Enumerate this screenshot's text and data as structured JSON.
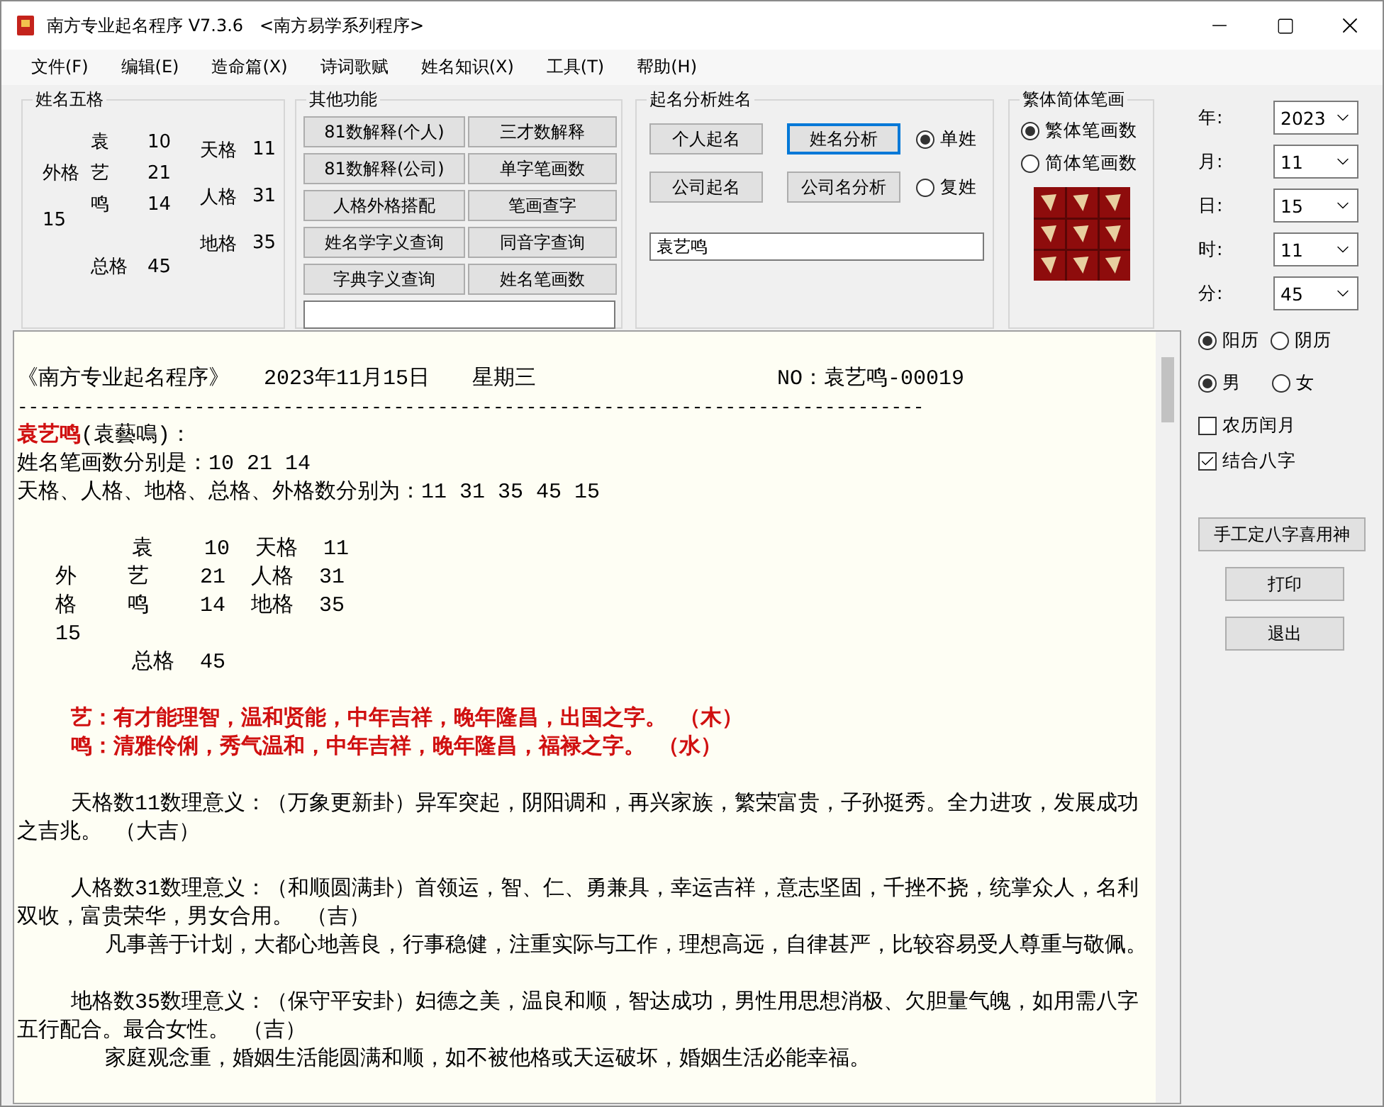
{
  "window": {
    "title": "南方专业起名程序 V7.3.6   <南方易学系列程序>"
  },
  "menu": [
    "文件(F)",
    "编辑(E)",
    "造命篇(X)",
    "诗词歌赋",
    "姓名知识(X)",
    "工具(T)",
    "帮助(H)"
  ],
  "five_grids": {
    "title": "姓名五格",
    "chars": [
      {
        "char": "袁",
        "strokes": "10"
      },
      {
        "char": "艺",
        "strokes": "21"
      },
      {
        "char": "鸣",
        "strokes": "14"
      }
    ],
    "outer": {
      "label": "外格",
      "value": "15"
    },
    "total": {
      "label": "总格",
      "value": "45"
    },
    "grids": [
      {
        "label": "天格",
        "value": "11"
      },
      {
        "label": "人格",
        "value": "31"
      },
      {
        "label": "地格",
        "value": "35"
      }
    ]
  },
  "other_functions": {
    "title": "其他功能",
    "buttons": [
      "81数解释(个人)",
      "三才数解释",
      "81数解释(公司)",
      "单字笔画数",
      "人格外格搭配",
      "笔画查字",
      "姓名学字义查询",
      "同音字查询",
      "字典字义查询",
      "姓名笔画数"
    ]
  },
  "name_analysis": {
    "title": "起名分析姓名",
    "buttons": [
      {
        "label": "个人起名",
        "focused": false
      },
      {
        "label": "姓名分析",
        "focused": true
      },
      {
        "label": "公司起名",
        "focused": false
      },
      {
        "label": "公司名分析",
        "focused": false
      }
    ],
    "surname_options": [
      {
        "label": "单姓",
        "selected": true
      },
      {
        "label": "复姓",
        "selected": false
      }
    ],
    "name_value": "袁艺鸣"
  },
  "stroke_type": {
    "title": "繁体简体笔画",
    "options": [
      {
        "label": "繁体笔画数",
        "selected": true
      },
      {
        "label": "简体笔画数",
        "selected": false
      }
    ]
  },
  "date_fields": [
    {
      "label": "年:",
      "value": "2023"
    },
    {
      "label": "月:",
      "value": "11"
    },
    {
      "label": "日:",
      "value": "15"
    },
    {
      "label": "时:",
      "value": "11"
    },
    {
      "label": "分:",
      "value": "45"
    }
  ],
  "calendar_options": [
    {
      "label": "阳历",
      "selected": true
    },
    {
      "label": "阴历",
      "selected": false
    }
  ],
  "gender_options": [
    {
      "label": "男",
      "selected": true
    },
    {
      "label": "女",
      "selected": false
    }
  ],
  "checkboxes": [
    {
      "label": "农历闰月",
      "checked": false
    },
    {
      "label": "结合八字",
      "checked": true
    }
  ],
  "action_buttons": [
    "手工定八字喜用神",
    "打印",
    "退出"
  ],
  "report": {
    "sections": [
      {
        "lines": [
          {
            "kind": "header",
            "parts": [
              "《南方专业起名程序》",
              "2023年11月15日",
              "星期三",
              "NO：袁艺鸣-00019"
            ]
          },
          {
            "kind": "rule",
            "text": "----------------------------------------------------------------------------------"
          },
          {
            "kind": "name",
            "name": "袁艺鸣",
            "text": "(袁藝鳴)："
          },
          {
            "kind": "plain",
            "text": "姓名笔画数分别是：10 21 14"
          },
          {
            "kind": "plain",
            "text": "天格、人格、地格、总格、外格数分别为：11 31 35 45 15"
          }
        ]
      },
      {
        "lines": [
          {
            "kind": "pre",
            "text": "         袁    10  天格  11"
          },
          {
            "kind": "pre",
            "text": "   外    艺    21  人格  31"
          },
          {
            "kind": "pre",
            "text": "   格    鸣    14  地格  35"
          },
          {
            "kind": "pre",
            "text": "   15"
          },
          {
            "kind": "pre",
            "text": "         总格  45"
          }
        ]
      },
      {
        "lines": [
          {
            "kind": "red",
            "text": "艺：有才能理智，温和贤能，中年吉祥，晚年隆昌，出国之字。  （木）"
          },
          {
            "kind": "red",
            "text": "鸣：清雅伶俐，秀气温和，中年吉祥，晚年隆昌，福禄之字。  （水）"
          }
        ]
      },
      {
        "lines": [
          {
            "kind": "para",
            "text": "天格数11数理意义：（万象更新卦）异军突起，阴阳调和，再兴家族，繁荣富贵，子孙挺秀。全力进攻，发展成功之吉兆。 （大吉）"
          }
        ]
      },
      {
        "lines": [
          {
            "kind": "para",
            "text": "人格数31数理意义：（和顺圆满卦）首领运，智、仁、勇兼具，幸运吉祥，意志坚固，千挫不挠，统掌众人，名利双收，富贵荣华，男女合用。 （吉）"
          },
          {
            "kind": "subpara",
            "text": "凡事善于计划，大都心地善良，行事稳健，注重实际与工作，理想高远，自律甚严，比较容易受人尊重与敬佩。"
          }
        ]
      },
      {
        "lines": [
          {
            "kind": "para",
            "text": "地格数35数理意义：（保守平安卦）妇德之美，温良和顺，智达成功，男性用思想消极、欠胆量气魄，如用需八字五行配合。最合女性。 （吉）"
          },
          {
            "kind": "subpara",
            "text": "家庭观念重，婚姻生活能圆满和顺，如不被他格或天运破坏，婚姻生活必能幸福。"
          }
        ]
      }
    ]
  }
}
